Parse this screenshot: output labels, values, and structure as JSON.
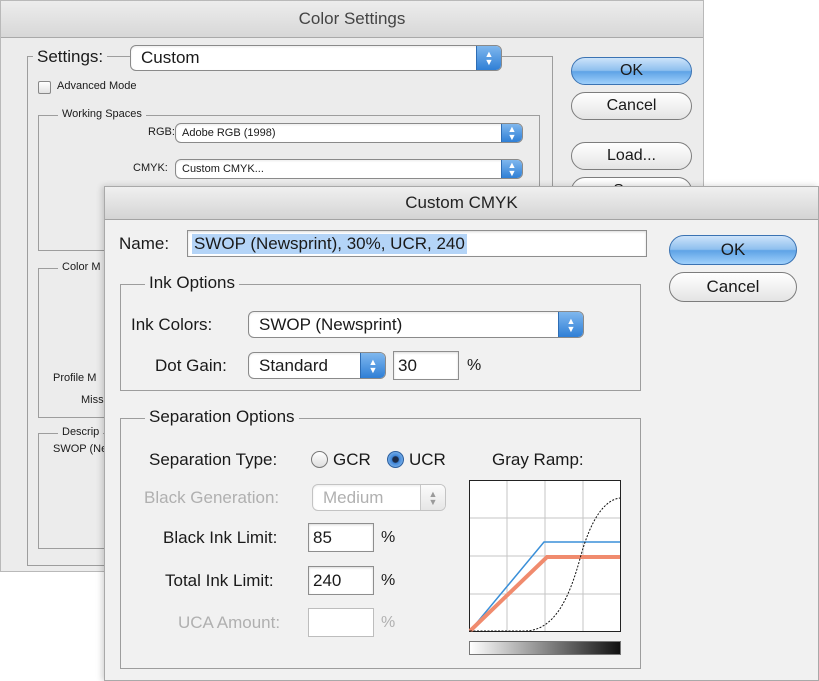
{
  "color_settings": {
    "title": "Color Settings",
    "settings_label": "Settings:",
    "settings_value": "Custom",
    "advanced_mode_label": "Advanced Mode",
    "working_spaces_legend": "Working Spaces",
    "rgb_label": "RGB:",
    "rgb_value": "Adobe RGB (1998)",
    "cmyk_label": "CMYK:",
    "cmyk_value": "Custom CMYK...",
    "color_management_legend_partial": "Color M",
    "profile_mismatches_partial": "Profile M",
    "missing_profiles_partial": "Missir",
    "description_legend_partial": "Descrip",
    "description_text_partial": "SWOP (Ne",
    "buttons": {
      "ok": "OK",
      "cancel": "Cancel",
      "load": "Load...",
      "save_partial": "Save"
    }
  },
  "custom_cmyk": {
    "title": "Custom CMYK",
    "name_label": "Name:",
    "name_value": "SWOP (Newsprint), 30%, UCR, 240",
    "ok_button": "OK",
    "cancel_button": "Cancel",
    "ink_options": {
      "legend": "Ink Options",
      "ink_colors_label": "Ink Colors:",
      "ink_colors_value": "SWOP (Newsprint)",
      "dot_gain_label": "Dot Gain:",
      "dot_gain_mode": "Standard",
      "dot_gain_value": "30",
      "dot_gain_unit": "%"
    },
    "separation_options": {
      "legend": "Separation Options",
      "type_label": "Separation Type:",
      "gcr_label": "GCR",
      "ucr_label": "UCR",
      "selected_type": "UCR",
      "black_generation_label": "Black Generation:",
      "black_generation_value": "Medium",
      "black_ink_limit_label": "Black Ink Limit:",
      "black_ink_limit_value": "85",
      "total_ink_limit_label": "Total Ink Limit:",
      "total_ink_limit_value": "240",
      "uca_amount_label": "UCA Amount:",
      "uca_amount_value": "",
      "percent": "%",
      "gray_ramp_label": "Gray Ramp:"
    },
    "colors": {
      "cyan_curve": "#3a8fd8",
      "magenta_yellow_curve": "#f08b6e",
      "black_curve": "#111111",
      "default_button": "#6aaeea"
    }
  }
}
